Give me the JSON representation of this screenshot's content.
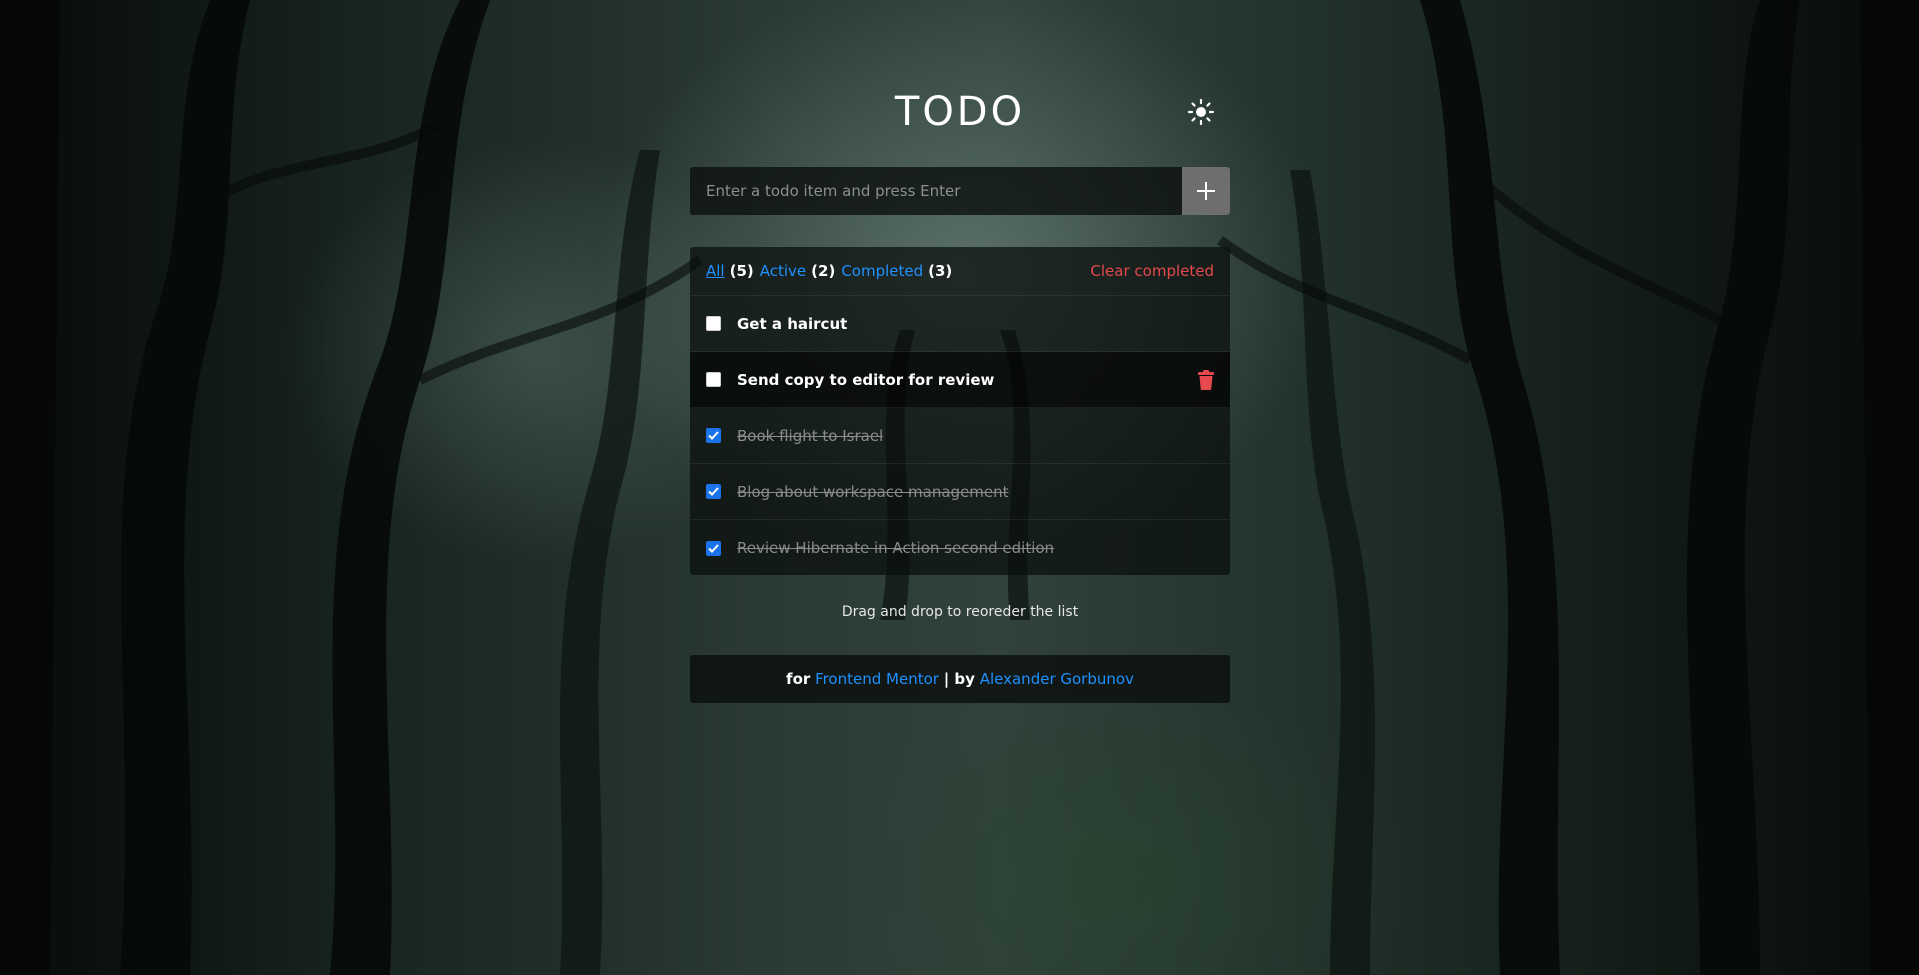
{
  "app": {
    "title": "TODO",
    "theme_toggle_icon": "sun-icon"
  },
  "new_todo": {
    "placeholder": "Enter a todo item and press Enter",
    "value": "",
    "add_icon": "plus-icon"
  },
  "filters": {
    "all_label": "All",
    "all_count": "(5)",
    "active_label": "Active",
    "active_count": "(2)",
    "completed_label": "Completed",
    "completed_count": "(3)",
    "selected": "All",
    "clear_label": "Clear completed"
  },
  "todos": [
    {
      "text": "Get a haircut",
      "completed": false
    },
    {
      "text": "Send copy to editor for review",
      "completed": false
    },
    {
      "text": "Book flight to Israel",
      "completed": true
    },
    {
      "text": "Blog about workspace management",
      "completed": true
    },
    {
      "text": "Review Hibernate in Action second edition",
      "completed": true
    }
  ],
  "hint": "Drag and drop to reoreder the list",
  "footer": {
    "prefix": "for",
    "link1": "Frontend Mentor",
    "separator": "| by",
    "link2": "Alexander Gorbunov"
  },
  "colors": {
    "link": "#1e90ff",
    "danger": "#e5484d",
    "checkbox_checked": "#1a73e8",
    "add_button": "#6e6e6e"
  }
}
